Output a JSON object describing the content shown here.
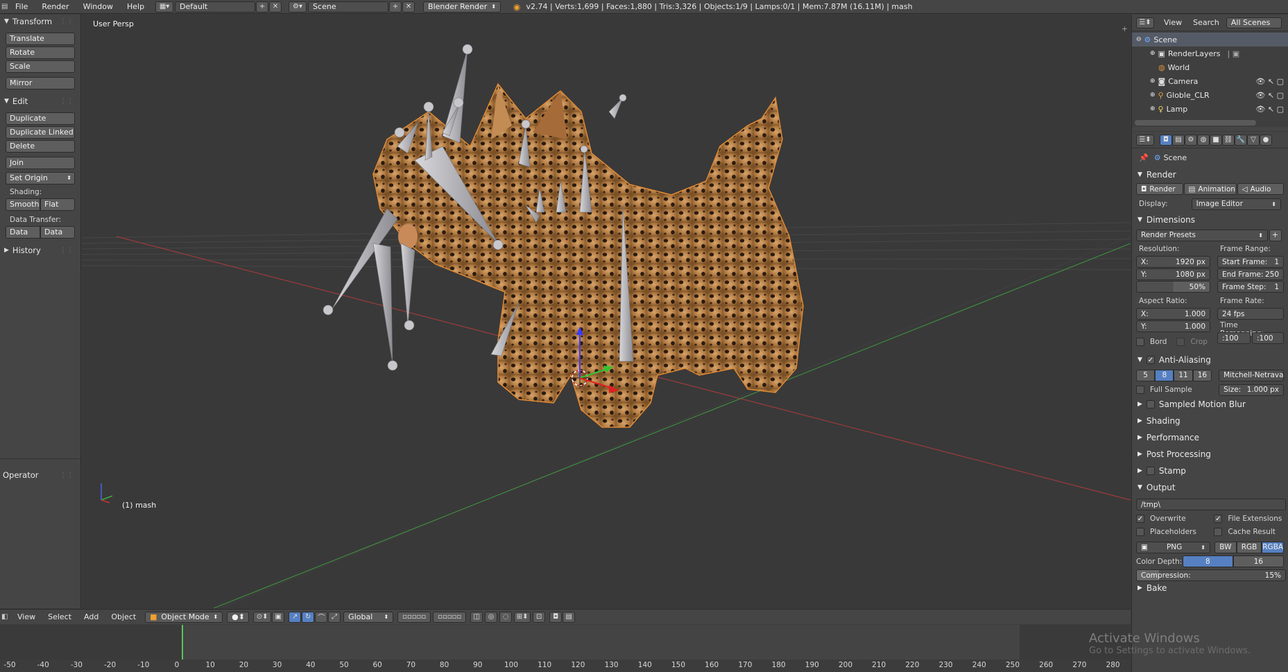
{
  "topbar": {
    "menus": [
      "File",
      "Render",
      "Window",
      "Help"
    ],
    "layout": "Default",
    "scene": "Scene",
    "engine": "Blender Render",
    "stats": "v2.74 | Verts:1,699 | Faces:1,880 | Tris:3,326 | Objects:1/9 | Lamps:0/1 | Mem:7.87M (16.11M) | mash"
  },
  "toolshelf": {
    "transform_title": "Transform",
    "translate": "Translate",
    "rotate": "Rotate",
    "scale": "Scale",
    "mirror": "Mirror",
    "edit_title": "Edit",
    "duplicate": "Duplicate",
    "duplicate_linked": "Duplicate Linked",
    "delete": "Delete",
    "join": "Join",
    "set_origin": "Set Origin",
    "shading_label": "Shading:",
    "smooth": "Smooth",
    "flat": "Flat",
    "data_transfer_label": "Data Transfer:",
    "data": "Data",
    "data_layout": "Data Layo",
    "history_title": "History",
    "operator_title": "Operator"
  },
  "viewport": {
    "view_label": "User Persp",
    "object_label": "(1) mash"
  },
  "vheader": {
    "menus": [
      "View",
      "Select",
      "Add",
      "Object"
    ],
    "mode": "Object Mode",
    "orientation": "Global"
  },
  "timeline": {
    "ticks": [
      "-50",
      "-40",
      "-30",
      "-20",
      "-10",
      "0",
      "10",
      "20",
      "30",
      "40",
      "50",
      "60",
      "70",
      "80",
      "90",
      "100",
      "110",
      "120",
      "130",
      "140",
      "150",
      "160",
      "170",
      "180",
      "190",
      "200",
      "210",
      "220",
      "230",
      "240",
      "250",
      "260",
      "270",
      "280"
    ],
    "current_frame": 0
  },
  "outliner": {
    "view": "View",
    "search": "Search",
    "filter": "All Scenes",
    "items": [
      "Scene",
      "RenderLayers",
      "World",
      "Camera",
      "Globle_CLR",
      "Lamp"
    ]
  },
  "properties": {
    "scene_label": "Scene",
    "render_title": "Render",
    "render_btn": "Render",
    "animation_btn": "Animation",
    "audio_btn": "Audio",
    "display_label": "Display:",
    "display_value": "Image Editor",
    "dimensions_title": "Dimensions",
    "render_presets": "Render Presets",
    "resolution_label": "Resolution:",
    "res_x_label": "X:",
    "res_x": "1920 px",
    "res_y_label": "Y:",
    "res_y": "1080 px",
    "res_pct": "50%",
    "frame_range_label": "Frame Range:",
    "start_frame": "Start Frame:",
    "start_frame_val": "1",
    "end_frame": "End Frame:",
    "end_frame_val": "250",
    "frame_step": "Frame Step:",
    "frame_step_val": "1",
    "aspect_label": "Aspect Ratio:",
    "aspect_x_label": "X:",
    "aspect_x": "1.000",
    "aspect_y_label": "Y:",
    "aspect_y": "1.000",
    "frame_rate_label": "Frame Rate:",
    "frame_rate": "24 fps",
    "time_remap_label": "Time Remapping:",
    "remap_old": ":100",
    "remap_new": ":100",
    "bord": "Bord",
    "crop": "Crop",
    "aa_title": "Anti-Aliasing",
    "aa_samples": [
      "5",
      "8",
      "11",
      "16"
    ],
    "aa_filter": "Mitchell-Netravali",
    "full_sample": "Full Sample",
    "size_label": "Size:",
    "size_val": "1.000 px",
    "motion_blur": "Sampled Motion Blur",
    "shading": "Shading",
    "performance": "Performance",
    "post_processing": "Post Processing",
    "stamp": "Stamp",
    "output_title": "Output",
    "output_path": "/tmp\\",
    "overwrite": "Overwrite",
    "file_extensions": "File Extensions",
    "placeholders": "Placeholders",
    "cache_result": "Cache Result",
    "format": "PNG",
    "bw": "BW",
    "rgb": "RGB",
    "rgba": "RGBA",
    "color_depth_label": "Color Depth:",
    "depth_8": "8",
    "depth_16": "16",
    "compression_label": "Compression:",
    "compression_val": "15%",
    "bake": "Bake"
  },
  "watermark": {
    "line1": "Activate Windows",
    "line2": "Go to Settings to activate Windows."
  },
  "colors": {
    "accent_blue": "#5680c2",
    "grid_red": "#b33a3a",
    "grid_green": "#3f8f3f",
    "leopard": "#b87836"
  }
}
